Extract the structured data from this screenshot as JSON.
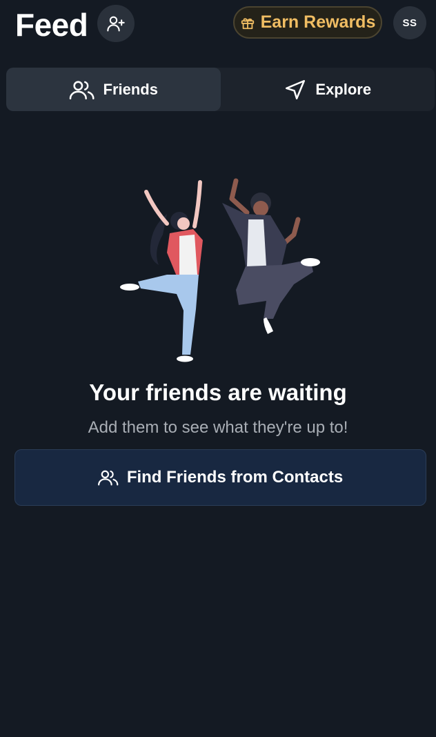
{
  "header": {
    "title": "Feed",
    "rewards_label": "Earn Rewards",
    "avatar_initials": "SS"
  },
  "tabs": [
    {
      "label": "Friends",
      "icon": "users-icon",
      "active": true
    },
    {
      "label": "Explore",
      "icon": "navigation-arrow-icon",
      "active": false
    }
  ],
  "empty_state": {
    "title": "Your friends are waiting",
    "subtitle": "Add them to see what they're up to!",
    "button_label": "Find Friends from Contacts"
  },
  "colors": {
    "background": "#141a23",
    "accent_gold": "#f0bd63",
    "button_blue": "#182841",
    "woman_top": "#e0585f",
    "jeans": "#a8c8ec"
  }
}
